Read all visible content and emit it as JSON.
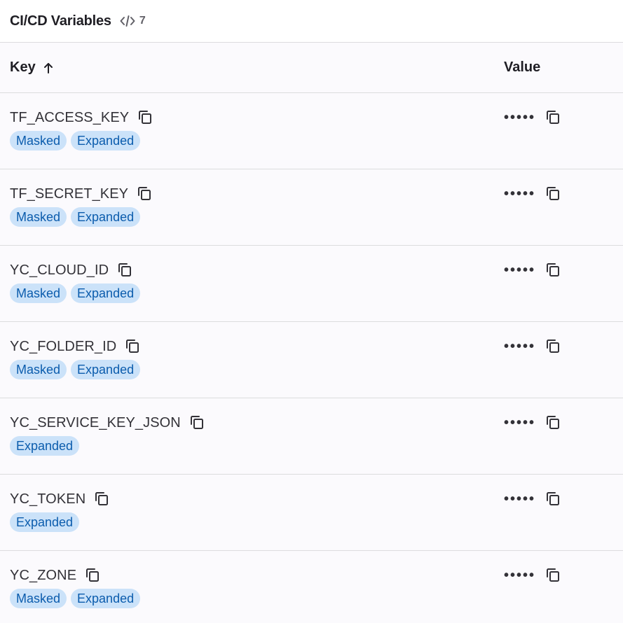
{
  "header": {
    "title": "CI/CD Variables",
    "count": "7",
    "count_icon": "code-icon"
  },
  "columns": {
    "key": "Key",
    "key_sort_icon": "arrow-up-icon",
    "value": "Value"
  },
  "rows": [
    {
      "key": "TF_ACCESS_KEY",
      "value": "•••••",
      "badges": [
        "Masked",
        "Expanded"
      ]
    },
    {
      "key": "TF_SECRET_KEY",
      "value": "•••••",
      "badges": [
        "Masked",
        "Expanded"
      ]
    },
    {
      "key": "YC_CLOUD_ID",
      "value": "•••••",
      "badges": [
        "Masked",
        "Expanded"
      ]
    },
    {
      "key": "YC_FOLDER_ID",
      "value": "•••••",
      "badges": [
        "Masked",
        "Expanded"
      ]
    },
    {
      "key": "YC_SERVICE_KEY_JSON",
      "value": "•••••",
      "badges": [
        "Expanded"
      ]
    },
    {
      "key": "YC_TOKEN",
      "value": "•••••",
      "badges": [
        "Expanded"
      ]
    },
    {
      "key": "YC_ZONE",
      "value": "•••••",
      "badges": [
        "Masked",
        "Expanded"
      ]
    }
  ],
  "colors": {
    "badge_bg": "#cbe2f9",
    "badge_text": "#0b5cad",
    "row_bg": "#fbfafd",
    "border": "#dcdcde"
  }
}
